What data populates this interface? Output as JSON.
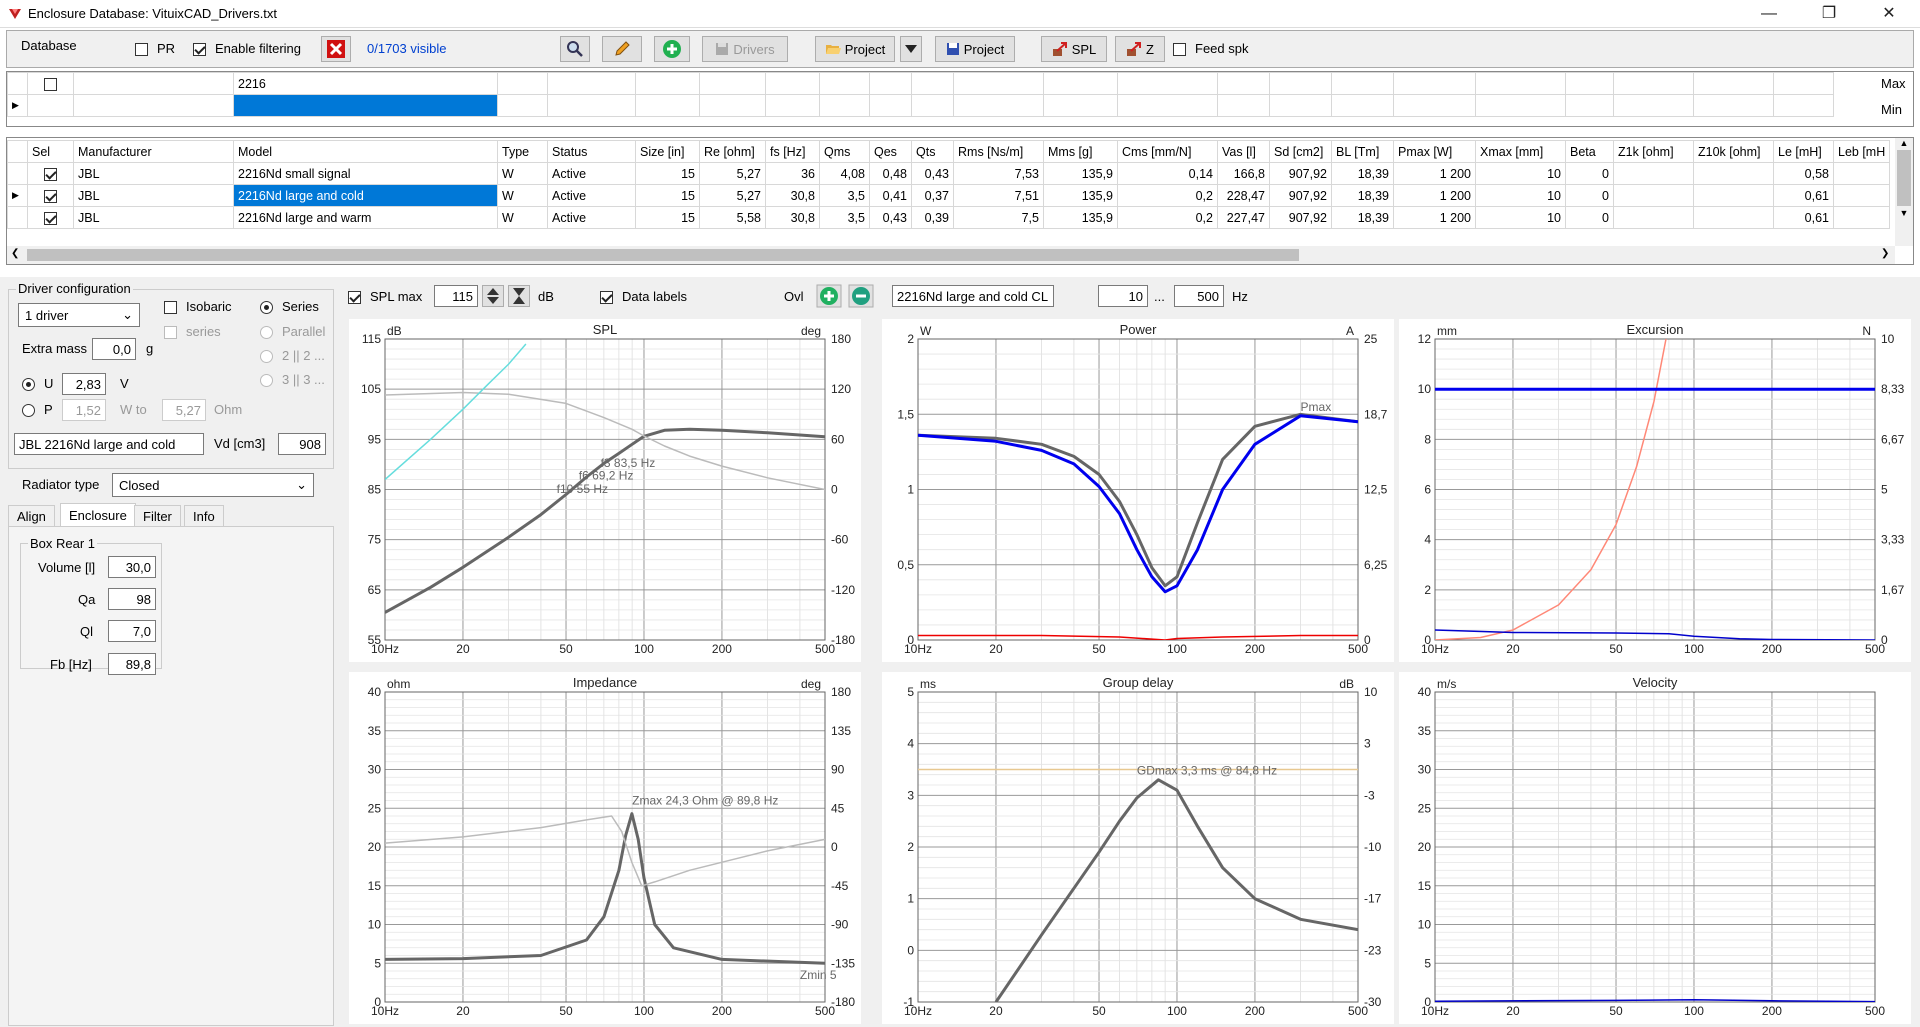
{
  "window": {
    "title": "Enclosure  Database: VituixCAD_Drivers.txt"
  },
  "toolbar": {
    "database_label": "Database",
    "pr_label": "PR",
    "enable_filtering_label": "Enable filtering",
    "visible_count": "0/1703 visible",
    "drivers_label": "Drivers",
    "project_label": "Project",
    "project2_label": "Project",
    "spl_label": "SPL",
    "z_label": "Z",
    "feed_spk_label": "Feed spk"
  },
  "filter": {
    "model_filter": "2216",
    "max_label": "Max",
    "min_label": "Min"
  },
  "table": {
    "columns": [
      "Sel",
      "Manufacturer",
      "Model",
      "Type",
      "Status",
      "Size [in]",
      "Re [ohm]",
      "fs [Hz]",
      "Qms",
      "Qes",
      "Qts",
      "Rms [Ns/m]",
      "Mms [g]",
      "Cms [mm/N]",
      "Vas [l]",
      "Sd [cm2]",
      "BL [Tm]",
      "Pmax [W]",
      "Xmax [mm]",
      "Beta",
      "Z1k [ohm]",
      "Z10k [ohm]",
      "Le [mH]",
      "Leb [mH"
    ],
    "rows": [
      [
        "JBL",
        "2216Nd small signal",
        "W",
        "Active",
        "15",
        "5,27",
        "36",
        "4,08",
        "0,48",
        "0,43",
        "7,53",
        "135,9",
        "0,14",
        "166,8",
        "907,92",
        "18,39",
        "1 200",
        "10",
        "0",
        "",
        "",
        "0,58",
        ""
      ],
      [
        "JBL",
        "2216Nd large and cold",
        "W",
        "Active",
        "15",
        "5,27",
        "30,8",
        "3,5",
        "0,41",
        "0,37",
        "7,51",
        "135,9",
        "0,2",
        "228,47",
        "907,92",
        "18,39",
        "1 200",
        "10",
        "0",
        "",
        "",
        "0,61",
        ""
      ],
      [
        "JBL",
        "2216Nd large and warm",
        "W",
        "Active",
        "15",
        "5,58",
        "30,8",
        "3,5",
        "0,43",
        "0,39",
        "7,5",
        "135,9",
        "0,2",
        "227,47",
        "907,92",
        "18,39",
        "1 200",
        "10",
        "0",
        "",
        "",
        "0,61",
        ""
      ]
    ]
  },
  "driver_config": {
    "group_label": "Driver configuration",
    "count": "1 driver",
    "isobaric_label": "Isobaric",
    "series_sub_label": "series",
    "series_label": "Series",
    "parallel_label": "Parallel",
    "opt_22": "2 || 2 ...",
    "opt_33": "3 || 3 ...",
    "extra_mass_label": "Extra mass",
    "extra_mass": "0,0",
    "extra_mass_unit": "g",
    "u_label": "U",
    "u_value": "2,83",
    "u_unit": "V",
    "p_label": "P",
    "p_value": "1,52",
    "w_to_label": "W to",
    "ohm_value": "5,27",
    "ohm_label": "Ohm",
    "driver_name": "JBL 2216Nd large and cold",
    "vd_label": "Vd [cm3]",
    "vd_value": "908"
  },
  "radiator": {
    "label": "Radiator type",
    "value": "Closed"
  },
  "tabs": [
    "Align",
    "Enclosure",
    "Filter",
    "Info"
  ],
  "box": {
    "group_label": "Box Rear 1",
    "volume_label": "Volume [l]",
    "volume": "30,0",
    "qa_label": "Qa",
    "qa": "98",
    "ql_label": "Ql",
    "ql": "7,0",
    "fb_label": "Fb [Hz]",
    "fb": "89,8"
  },
  "graph_controls": {
    "spl_max_label": "SPL max",
    "spl_max": "115",
    "db_label": "dB",
    "data_labels_label": "Data labels",
    "ovl_label": "Ovl",
    "overlay_name": "2216Nd large and cold CL",
    "f_from": "10",
    "f_sep": "...",
    "f_to": "500",
    "hz_label": "Hz"
  },
  "chart_data": [
    {
      "type": "line",
      "title": "SPL",
      "ylabel_left": "dB",
      "ylabel_right": "deg",
      "x_ticks": [
        "10Hz",
        "20",
        "50",
        "100",
        "200",
        "500"
      ],
      "y_ticks_left": [
        "115",
        "105",
        "95",
        "85",
        "75",
        "65",
        "55"
      ],
      "y_ticks_right": [
        "180",
        "120",
        "60",
        "0",
        "-60",
        "-120",
        "-180"
      ],
      "ylim": [
        55,
        115
      ],
      "ylim_right": [
        -180,
        180
      ],
      "xlim": [
        10,
        500
      ],
      "x_scale": "log",
      "annotations": [
        "f3 83,5 Hz",
        "f6 69,2 Hz",
        "f10 55 Hz"
      ],
      "series": [
        {
          "color": "#666666",
          "x": [
            10,
            15,
            20,
            30,
            40,
            50,
            60,
            70,
            80,
            90,
            100,
            120,
            150,
            200,
            300,
            500
          ],
          "y": [
            60.5,
            65.5,
            69.5,
            75.5,
            80,
            84,
            87.5,
            90.2,
            92.2,
            94,
            95.6,
            96.8,
            97,
            96.8,
            96.3,
            95.5
          ]
        },
        {
          "color": "#bbbbbb",
          "x": [
            10,
            20,
            30,
            50,
            70,
            90,
            100,
            120,
            150,
            200,
            300,
            500
          ],
          "y": [
            113,
            116,
            114,
            103,
            86,
            72,
            64,
            52,
            40,
            28,
            14,
            0
          ]
        },
        {
          "color": "#66dddd",
          "x": [
            10,
            15,
            20,
            25,
            30,
            35
          ],
          "y": [
            87,
            95,
            101,
            106,
            110,
            114
          ]
        }
      ]
    },
    {
      "type": "line",
      "title": "Power",
      "ylabel_left": "W",
      "ylabel_right": "A",
      "x_ticks": [
        "10Hz",
        "20",
        "50",
        "100",
        "200",
        "500"
      ],
      "y_ticks_left": [
        "2",
        "1,5",
        "1",
        "0,5",
        "0"
      ],
      "y_ticks_right": [
        "25",
        "18,7",
        "12,5",
        "6,25",
        "0"
      ],
      "ylim": [
        0,
        2
      ],
      "xlim": [
        10,
        500
      ],
      "x_scale": "log",
      "annotations": [
        "Pmax"
      ],
      "series": [
        {
          "color": "#666666",
          "x": [
            10,
            20,
            30,
            40,
            50,
            60,
            70,
            80,
            90,
            100,
            120,
            150,
            200,
            300,
            500
          ],
          "y": [
            1.36,
            1.34,
            1.3,
            1.22,
            1.1,
            0.92,
            0.7,
            0.48,
            0.36,
            0.42,
            0.78,
            1.2,
            1.42,
            1.5,
            1.45
          ]
        },
        {
          "color": "#0000ee",
          "x": [
            10,
            20,
            30,
            40,
            50,
            60,
            70,
            80,
            90,
            100,
            120,
            150,
            200,
            300,
            500
          ],
          "y": [
            1.36,
            1.32,
            1.26,
            1.17,
            1.02,
            0.84,
            0.6,
            0.42,
            0.32,
            0.36,
            0.6,
            1.0,
            1.3,
            1.49,
            1.45
          ]
        },
        {
          "color": "#ee0000",
          "x": [
            10,
            30,
            60,
            90,
            100,
            150,
            300,
            500
          ],
          "y": [
            0.03,
            0.03,
            0.02,
            0.0,
            0.01,
            0.02,
            0.03,
            0.03
          ]
        }
      ]
    },
    {
      "type": "line",
      "title": "Excursion",
      "ylabel_left": "mm",
      "ylabel_right": "N",
      "x_ticks": [
        "10Hz",
        "20",
        "50",
        "100",
        "200",
        "500"
      ],
      "y_ticks_left": [
        "12",
        "10",
        "8",
        "6",
        "4",
        "2",
        "0"
      ],
      "y_ticks_right": [
        "10",
        "8,33",
        "6,67",
        "5",
        "3,33",
        "1,67",
        "0"
      ],
      "ylim": [
        0,
        12
      ],
      "xlim": [
        10,
        500
      ],
      "x_scale": "log",
      "series": [
        {
          "color": "#ff8877",
          "x": [
            10,
            15,
            20,
            30,
            40,
            50,
            60,
            70,
            78
          ],
          "y": [
            0,
            0.1,
            0.4,
            1.4,
            2.8,
            4.6,
            6.9,
            9.5,
            12
          ]
        },
        {
          "color": "#0000cc",
          "x": [
            10,
            20,
            50,
            80,
            100,
            150,
            200,
            500
          ],
          "y": [
            0.4,
            0.3,
            0.28,
            0.25,
            0.15,
            0.05,
            0.02,
            0.0
          ]
        },
        {
          "color": "#0000ee",
          "x": [
            10,
            500
          ],
          "y": [
            10,
            10
          ]
        }
      ]
    },
    {
      "type": "line",
      "title": "Impedance",
      "ylabel_left": "ohm",
      "ylabel_right": "deg",
      "x_ticks": [
        "10Hz",
        "20",
        "50",
        "100",
        "200",
        "500"
      ],
      "y_ticks_left": [
        "40",
        "35",
        "30",
        "25",
        "20",
        "15",
        "10",
        "5",
        "0"
      ],
      "y_ticks_right": [
        "180",
        "135",
        "90",
        "45",
        "0",
        "-45",
        "-90",
        "-135",
        "-180"
      ],
      "ylim": [
        0,
        40
      ],
      "xlim": [
        10,
        500
      ],
      "x_scale": "log",
      "annotations": [
        "Zmax 24,3 Ohm @ 89,8 Hz",
        "Zmin 5"
      ],
      "series": [
        {
          "color": "#666666",
          "x": [
            10,
            20,
            40,
            60,
            70,
            80,
            85,
            89.8,
            95,
            100,
            110,
            130,
            200,
            500
          ],
          "y": [
            5.5,
            5.6,
            6,
            8,
            11,
            17,
            21.5,
            24.3,
            21,
            16,
            10,
            7,
            5.5,
            5
          ]
        },
        {
          "color": "#bbbbbb",
          "x": [
            10,
            20,
            40,
            60,
            75,
            82,
            89.8,
            98,
            110,
            150,
            300,
            500
          ],
          "y": [
            20.5,
            21.3,
            22.5,
            23.5,
            24,
            22,
            18,
            15,
            15.5,
            17,
            19.5,
            21
          ]
        }
      ]
    },
    {
      "type": "line",
      "title": "Group delay",
      "ylabel_left": "ms",
      "ylabel_right": "dB",
      "x_ticks": [
        "10Hz",
        "20",
        "50",
        "100",
        "200",
        "500"
      ],
      "y_ticks_left": [
        "5",
        "4",
        "3",
        "2",
        "1",
        "0",
        "-1"
      ],
      "y_ticks_right": [
        "10",
        "3",
        "-3",
        "-10",
        "-17",
        "-23",
        "-30"
      ],
      "ylim": [
        -1,
        5
      ],
      "xlim": [
        10,
        500
      ],
      "x_scale": "log",
      "annotations": [
        "GDmax 3,3 ms  @ 84,8 Hz"
      ],
      "series": [
        {
          "color": "#666666",
          "x": [
            20,
            30,
            40,
            50,
            60,
            70,
            84.8,
            100,
            120,
            150,
            200,
            300,
            500
          ],
          "y": [
            -1,
            0.3,
            1.2,
            1.9,
            2.5,
            2.95,
            3.3,
            3.1,
            2.4,
            1.6,
            1.0,
            0.6,
            0.4
          ]
        },
        {
          "color": "#e8c890",
          "x": [
            10,
            500
          ],
          "y": [
            3.5,
            3.5
          ]
        }
      ]
    },
    {
      "type": "line",
      "title": "Velocity",
      "ylabel_left": "m/s",
      "x_ticks": [
        "10Hz",
        "20",
        "50",
        "100",
        "200",
        "500"
      ],
      "y_ticks_left": [
        "40",
        "35",
        "30",
        "25",
        "20",
        "15",
        "10",
        "5",
        "0"
      ],
      "ylim": [
        0,
        40
      ],
      "xlim": [
        10,
        500
      ],
      "x_scale": "log",
      "series": [
        {
          "color": "#0000cc",
          "x": [
            10,
            50,
            100,
            200,
            500
          ],
          "y": [
            0.1,
            0.2,
            0.3,
            0.15,
            0.05
          ]
        }
      ]
    }
  ]
}
